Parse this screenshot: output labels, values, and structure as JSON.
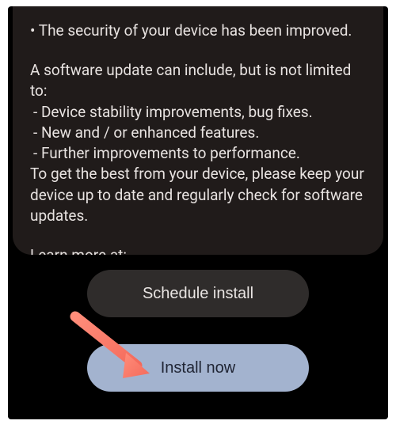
{
  "update": {
    "bullet": "• The security of your device has been improved.",
    "intro": "A software update can include, but is not limited to:",
    "items": [
      " - Device stability improvements, bug fixes.",
      " - New and / or enhanced features.",
      " - Further improvements to performance."
    ],
    "advice": "To get the best from your device, please keep your device up to date and regularly check for software updates.",
    "learn_more": "Learn more at:"
  },
  "buttons": {
    "schedule": "Schedule install",
    "install": "Install now"
  }
}
